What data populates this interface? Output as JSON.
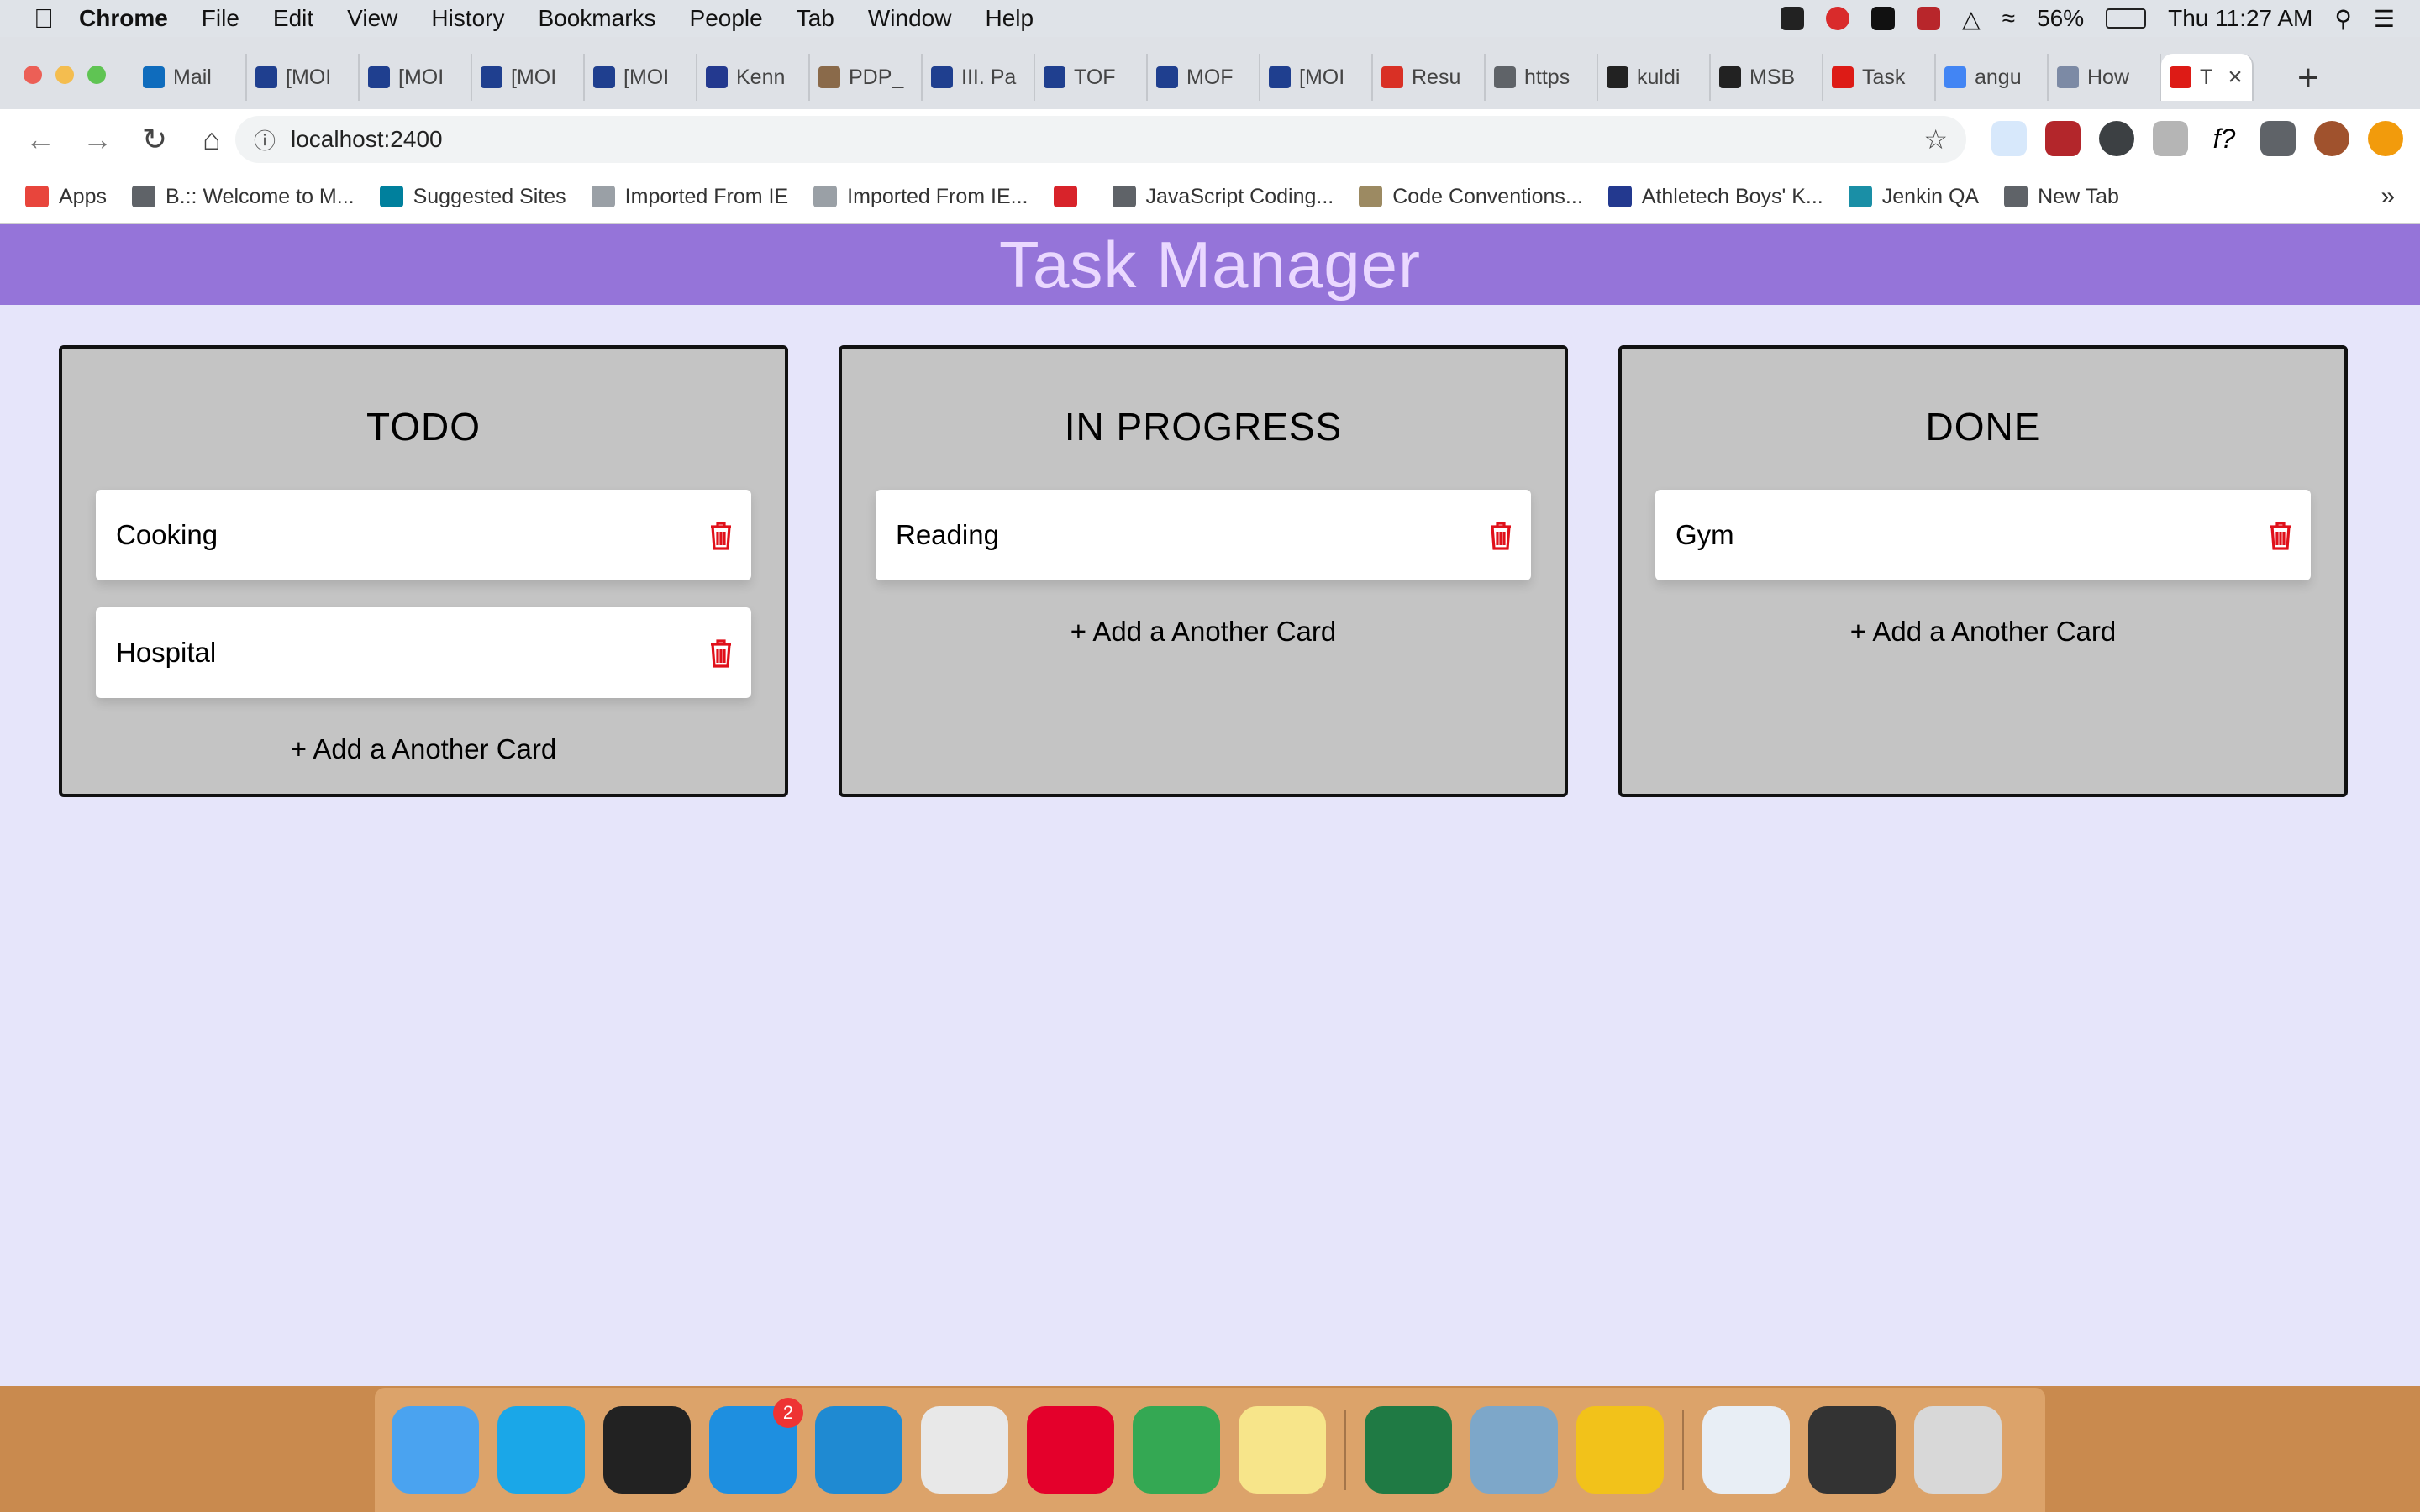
{
  "menubar": {
    "app": "Chrome",
    "items": [
      "File",
      "Edit",
      "View",
      "History",
      "Bookmarks",
      "People",
      "Tab",
      "Window",
      "Help"
    ],
    "battery": "56%",
    "clock": "Thu 11:27 AM"
  },
  "browser": {
    "tabs": [
      {
        "label": "Mail",
        "color": "#0f6cbd"
      },
      {
        "label": "[MOI",
        "color": "#1f3f8f"
      },
      {
        "label": "[MOI",
        "color": "#1f3f8f"
      },
      {
        "label": "[MOI",
        "color": "#1f3f8f"
      },
      {
        "label": "[MOI",
        "color": "#1f3f8f"
      },
      {
        "label": "Kenn",
        "color": "#23398f"
      },
      {
        "label": "PDP_",
        "color": "#8a6a4a"
      },
      {
        "label": "III. Pa",
        "color": "#1f3f8f"
      },
      {
        "label": "TOF",
        "color": "#1f3f8f"
      },
      {
        "label": "MOF",
        "color": "#1f3f8f"
      },
      {
        "label": "[MOI",
        "color": "#1f3f8f"
      },
      {
        "label": "Resu",
        "color": "#d93025"
      },
      {
        "label": "https",
        "color": "#5f6368"
      },
      {
        "label": "kuldi",
        "color": "#222222"
      },
      {
        "label": "MSB",
        "color": "#222222"
      },
      {
        "label": "Task",
        "color": "#dd1b16"
      },
      {
        "label": "angu",
        "color": "#4285f4"
      },
      {
        "label": "How",
        "color": "#7c8aa5"
      },
      {
        "label": "T",
        "color": "#dd1b16"
      }
    ],
    "active_tab_close": "×",
    "new_tab": "+",
    "url": "localhost:2400",
    "bookmarks": [
      {
        "label": "Apps",
        "color": "#e8453c"
      },
      {
        "label": "B.:: Welcome to M...",
        "color": "#5f6368"
      },
      {
        "label": "Suggested Sites",
        "color": "#00809d"
      },
      {
        "label": "Imported From IE",
        "color": "#9aa0a6"
      },
      {
        "label": "Imported From IE...",
        "color": "#9aa0a6"
      },
      {
        "label": "",
        "color": "#d8232a"
      },
      {
        "label": "JavaScript Coding...",
        "color": "#5f6368"
      },
      {
        "label": "Code Conventions...",
        "color": "#9c8a62"
      },
      {
        "label": "Athletech Boys' K...",
        "color": "#23398f"
      },
      {
        "label": "Jenkin QA",
        "color": "#1a8fa6"
      },
      {
        "label": "New Tab",
        "color": "#5f6368"
      }
    ],
    "bookmarks_more": "»"
  },
  "app": {
    "title": "Task Manager",
    "columns": [
      {
        "title": "TODO",
        "cards": [
          "Cooking",
          "Hospital"
        ],
        "add_label": "+ Add a Another Card"
      },
      {
        "title": "IN PROGRESS",
        "cards": [
          "Reading"
        ],
        "add_label": "+ Add a Another Card"
      },
      {
        "title": "DONE",
        "cards": [
          "Gym"
        ],
        "add_label": "+ Add a Another Card"
      }
    ],
    "colors": {
      "header": "#9574d9",
      "header_text": "#ead8ff",
      "background": "#e6e5fa",
      "column": "#c4c4c4",
      "trash": "#e0101a"
    }
  },
  "dock": {
    "icons": [
      {
        "name": "finder-icon",
        "color": "#4aa3f0"
      },
      {
        "name": "skype-icon",
        "color": "#1aa7e8"
      },
      {
        "name": "terminal-icon",
        "color": "#222222"
      },
      {
        "name": "skype-business-icon",
        "color": "#1e8fe0",
        "badge": "2"
      },
      {
        "name": "vscode-icon",
        "color": "#1f8ad2"
      },
      {
        "name": "script-editor-icon",
        "color": "#e8e8e8"
      },
      {
        "name": "f5-icon",
        "color": "#e4002b"
      },
      {
        "name": "chrome-icon",
        "color": "#34a853"
      },
      {
        "name": "stickies-icon",
        "color": "#f7e58a"
      },
      {
        "name": "excel-icon",
        "color": "#1f7a44"
      },
      {
        "name": "preview-icon",
        "color": "#7da7c9"
      },
      {
        "name": "norton-icon",
        "color": "#f2c21a"
      },
      {
        "name": "skype-window-icon",
        "color": "#e8eef5"
      },
      {
        "name": "chrome-window-icon",
        "color": "#333333"
      },
      {
        "name": "trash-icon",
        "color": "#d8d8d8"
      }
    ]
  }
}
